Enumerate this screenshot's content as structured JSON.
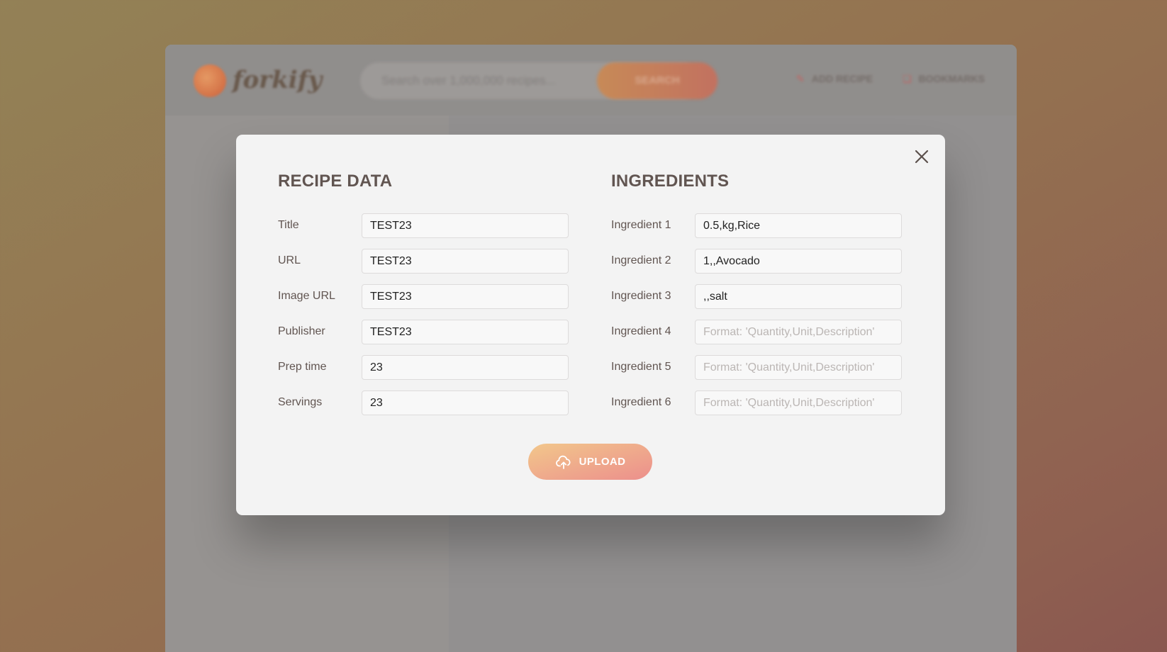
{
  "app": {
    "logo_text": "forkify",
    "search_placeholder": "Search over 1,000,000 recipes...",
    "search_button": "SEARCH",
    "nav_add_recipe": "ADD RECIPE",
    "nav_bookmarks": "BOOKMARKS"
  },
  "modal": {
    "recipe_section_title": "RECIPE DATA",
    "ingredients_section_title": "INGREDIENTS",
    "recipe_fields": [
      {
        "label": "Title",
        "value": "TEST23"
      },
      {
        "label": "URL",
        "value": "TEST23"
      },
      {
        "label": "Image URL",
        "value": "TEST23"
      },
      {
        "label": "Publisher",
        "value": "TEST23"
      },
      {
        "label": "Prep time",
        "value": "23"
      },
      {
        "label": "Servings",
        "value": "23"
      }
    ],
    "ingredient_fields": [
      {
        "label": "Ingredient 1",
        "value": "0.5,kg,Rice",
        "placeholder": "Format: 'Quantity,Unit,Description'"
      },
      {
        "label": "Ingredient 2",
        "value": "1,,Avocado",
        "placeholder": "Format: 'Quantity,Unit,Description'"
      },
      {
        "label": "Ingredient 3",
        "value": ",,salt",
        "placeholder": "Format: 'Quantity,Unit,Description'"
      },
      {
        "label": "Ingredient 4",
        "value": "",
        "placeholder": "Format: 'Quantity,Unit,Description'"
      },
      {
        "label": "Ingredient 5",
        "value": "",
        "placeholder": "Format: 'Quantity,Unit,Description'"
      },
      {
        "label": "Ingredient 6",
        "value": "",
        "placeholder": "Format: 'Quantity,Unit,Description'"
      }
    ],
    "upload_label": "UPLOAD"
  },
  "colors": {
    "accent_start": "#f2c78b",
    "accent_end": "#ec8f8c",
    "text": "#615551"
  },
  "icons": {
    "close": "close-icon",
    "upload": "upload-cloud-icon"
  }
}
